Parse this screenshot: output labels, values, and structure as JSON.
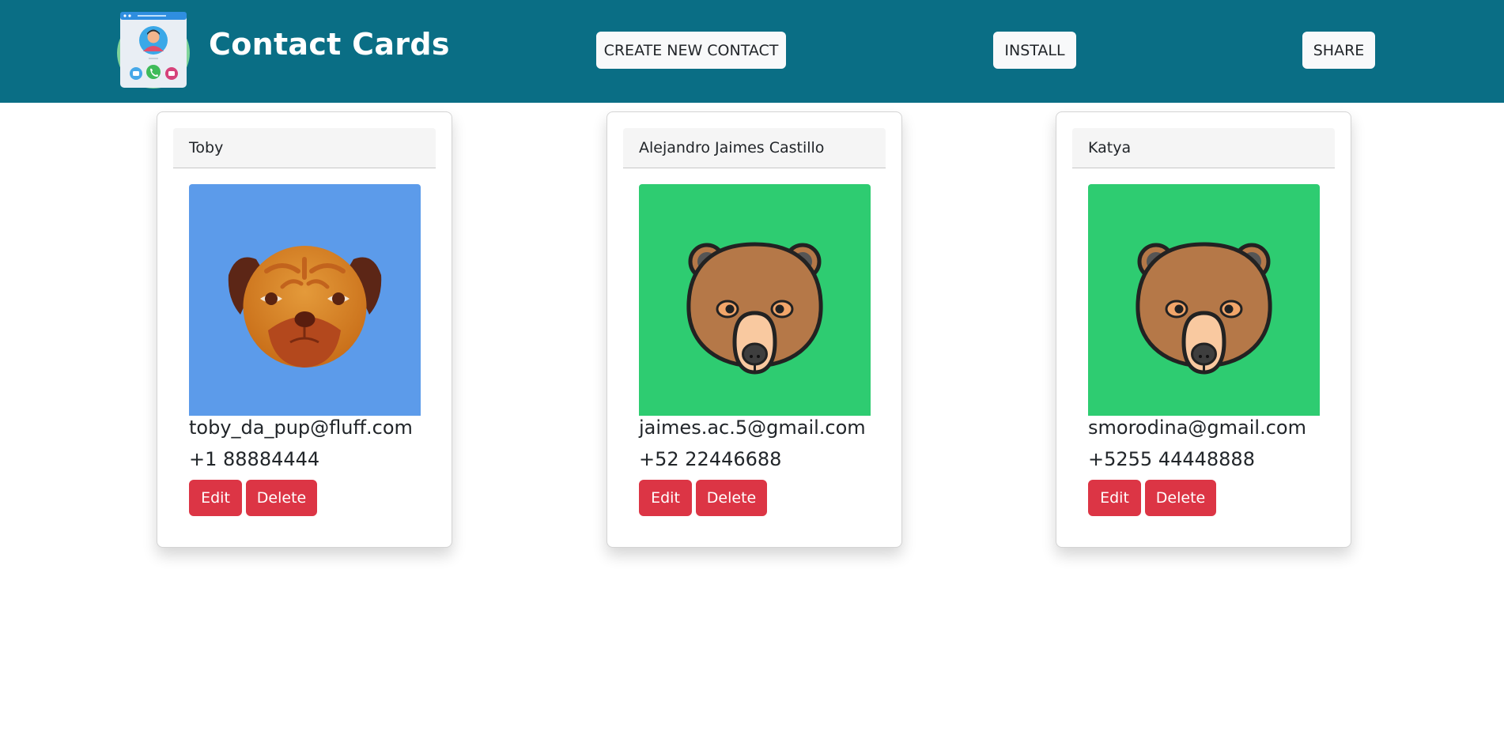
{
  "header": {
    "title": "Contact Cards",
    "logo": "contact-app-logo",
    "background": "#0a6e85",
    "buttons": {
      "create": "CREATE NEW CONTACT",
      "install": "INSTALL",
      "share": "SHARE"
    }
  },
  "contacts": [
    {
      "name": "Toby",
      "email": "toby_da_pup@fluff.com",
      "phone": "+1 88884444",
      "avatar": "pug-dog-icon",
      "avatar_bg": "#5c9bea",
      "edit_label": "Edit",
      "delete_label": "Delete"
    },
    {
      "name": "Alejandro Jaimes Castillo",
      "email": "jaimes.ac.5@gmail.com",
      "phone": "+52 22446688",
      "avatar": "bear-icon",
      "avatar_bg": "#2ecc71",
      "edit_label": "Edit",
      "delete_label": "Delete"
    },
    {
      "name": "Katya",
      "email": "smorodina@gmail.com",
      "phone": "+5255 44448888",
      "avatar": "bear-icon",
      "avatar_bg": "#2ecc71",
      "edit_label": "Edit",
      "delete_label": "Delete"
    }
  ],
  "colors": {
    "danger": "#dc3545",
    "light_button": "#f8f9fa"
  }
}
